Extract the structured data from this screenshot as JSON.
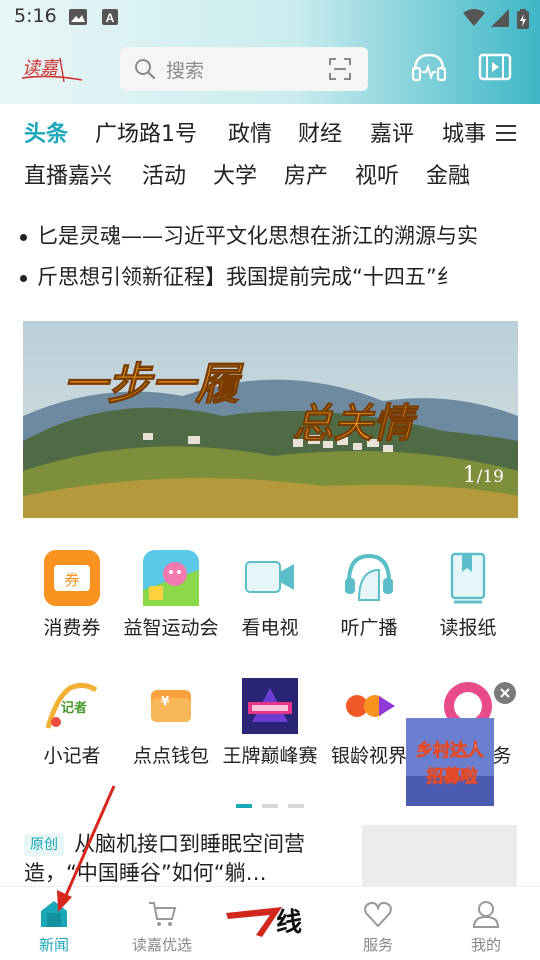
{
  "status_bar": {
    "time": "5:16",
    "icons": [
      "image-icon",
      "a-letter-icon",
      "wifi-icon",
      "signal-icon",
      "battery-charging-icon"
    ]
  },
  "header": {
    "logo_text": "读嘉",
    "search_placeholder": "搜索",
    "icons": [
      "search-icon",
      "scan-icon",
      "live-broadcast-icon",
      "video-icon"
    ]
  },
  "tabs": {
    "row1": [
      "头条",
      "广场路1号",
      "政情",
      "财经",
      "嘉评",
      "城事"
    ],
    "row2": [
      "直播嘉兴",
      "活动",
      "大学",
      "房产",
      "视听",
      "金融"
    ],
    "active": "头条"
  },
  "headlines": [
    "匕是灵魂——习近平文化思想在浙江的溯源与实",
    "斤思想引领新征程】我国提前完成“十四五”纟"
  ],
  "banner": {
    "title_art": "一步一履 总关情",
    "counter_current": "1",
    "counter_total": "/19"
  },
  "grid": {
    "row1": [
      {
        "label": "消费券",
        "icon": "coupon-icon",
        "color": "#f7931e"
      },
      {
        "label": "益智运动会",
        "icon": "puzzle-game-icon",
        "color": "#5ac8e8"
      },
      {
        "label": "看电视",
        "icon": "tv-camera-icon",
        "color": "#5bbec9"
      },
      {
        "label": "听广播",
        "icon": "headset-icon",
        "color": "#5bbec9"
      },
      {
        "label": "读报纸",
        "icon": "newspaper-bookmark-icon",
        "color": "#5bbec9"
      }
    ],
    "row2": [
      {
        "label": "小记者",
        "icon": "little-reporter-icon",
        "color": "#f2b134"
      },
      {
        "label": "点点钱包",
        "icon": "wallet-icon",
        "color": "#f7a23a"
      },
      {
        "label": "王牌巅峰赛",
        "icon": "ace-contest-icon",
        "color": "#3a3a9c"
      },
      {
        "label": "银龄视界",
        "icon": "silver-age-icon",
        "color": "#f05a28"
      },
      {
        "label": "务",
        "icon": "service-icon",
        "color": "#e94b8a"
      }
    ]
  },
  "float_ad": {
    "line1": "乡村达人",
    "line2": "招募啦"
  },
  "article": {
    "badge": "原创",
    "title": "从脑机接口到睡眠空间营造，“中国睡谷”如何“躺…"
  },
  "bottom_nav": [
    {
      "label": "新闻",
      "icon": "home-news-icon",
      "active": true
    },
    {
      "label": "读嘉优选",
      "icon": "shopping-cart-icon",
      "active": false
    },
    {
      "label": "一线",
      "icon": "yixian-logo-icon",
      "active": false
    },
    {
      "label": "服务",
      "icon": "heart-service-icon",
      "active": false
    },
    {
      "label": "我的",
      "icon": "profile-icon",
      "active": false
    }
  ],
  "colors": {
    "accent": "#1aa7b8",
    "annotation_arrow": "#d8281d"
  }
}
